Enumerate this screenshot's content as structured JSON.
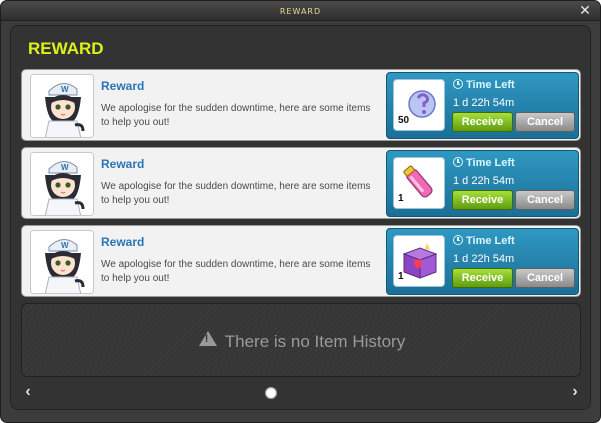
{
  "window": {
    "title": "REWARD",
    "close_label": "✕"
  },
  "heading": "REWARD",
  "rewards": [
    {
      "title": "Reward",
      "message": "We apologise for the sudden downtime, here are some items to help you out!",
      "time_label": "Time Left",
      "time_value": "1 d 22h 54m",
      "item_icon": "blue-orb-item-icon",
      "item_count": "50",
      "receive_label": "Receive",
      "cancel_label": "Cancel"
    },
    {
      "title": "Reward",
      "message": "We apologise for the sudden downtime, here are some items to help you out!",
      "time_label": "Time Left",
      "time_value": "1 d 22h 54m",
      "item_icon": "pink-potion-item-icon",
      "item_count": "1",
      "receive_label": "Receive",
      "cancel_label": "Cancel"
    },
    {
      "title": "Reward",
      "message": "We apologise for the sudden downtime, here are some items to help you out!",
      "time_label": "Time Left",
      "time_value": "1 d 22h 54m",
      "item_icon": "purple-gift-box-item-icon",
      "item_count": "1",
      "receive_label": "Receive",
      "cancel_label": "Cancel"
    }
  ],
  "history": {
    "text": "There is no Item History"
  },
  "pagination": {
    "prev_label": "‹",
    "next_label": "›"
  },
  "colors": {
    "accent": "#d9f21a",
    "reward_box": "#2a8db8",
    "receive": "#7fbf1f",
    "cancel": "#a8a8a8",
    "title_link": "#2a74b7"
  }
}
